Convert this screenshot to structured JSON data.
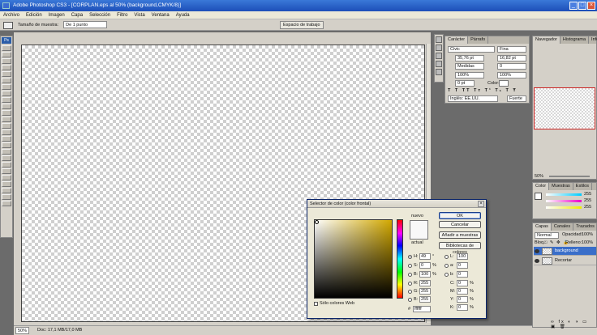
{
  "window": {
    "title": "Adobe Photoshop CS3 - [CORPLAN.eps al 50% (background,CMYK/8)]"
  },
  "menu": [
    "Archivo",
    "Edición",
    "Imagen",
    "Capa",
    "Selección",
    "Filtro",
    "Vista",
    "Ventana",
    "Ayuda"
  ],
  "options": {
    "sample_label": "Tamaño de muestra:",
    "sample_value": "De 1 punto",
    "workspace": "Espacio de trabajo"
  },
  "status": {
    "zoom": "50%",
    "doc": "Doc: 17,1 MB/17,0 MB"
  },
  "char_panel": {
    "tabs": [
      "Carácter",
      "Párrafo"
    ],
    "font": "Civic",
    "style": "Fina",
    "size": "35,76 pt",
    "leading": "16,82 pt",
    "kerning": "Medidas",
    "tracking": "0",
    "vscale": "100%",
    "hscale": "100%",
    "baseline": "0 pt",
    "color_label": "Color:",
    "language": "Inglés: EE.UU.",
    "aa": "Fuerte"
  },
  "nav_panel": {
    "tabs": [
      "Navegador",
      "Histograma",
      "Info"
    ],
    "zoom": "50%"
  },
  "color_panel": {
    "tabs": [
      "Color",
      "Muestras",
      "Estilos"
    ],
    "c": "255",
    "m": "255",
    "y": "255"
  },
  "layers_panel": {
    "tabs": [
      "Capas",
      "Canales",
      "Trazados"
    ],
    "mode": "Normal",
    "opacity_label": "Opacidad:",
    "opacity": "100%",
    "lock_label": "Bloq.:",
    "fill_label": "Relleno:",
    "fill": "100%",
    "layers": [
      {
        "name": "background",
        "selected": true
      },
      {
        "name": "Recortar",
        "selected": false
      }
    ]
  },
  "dialog": {
    "title": "Selector de color (color frontal)",
    "new_label": "nuevo",
    "current_label": "actual",
    "ok": "OK",
    "cancel": "Cancelar",
    "add_swatches": "Añadir a muestras",
    "libraries": "Bibliotecas de colores",
    "web_only": "Sólo colores Web",
    "h": "49",
    "s": "0",
    "b": "100",
    "r": "255",
    "g": "255",
    "bl": "255",
    "l": "100",
    "a": "0",
    "bb": "0",
    "c": "0",
    "m": "0",
    "y": "0",
    "k": "0",
    "hex": "ffffff",
    "deg": "°",
    "pct": "%"
  },
  "colors": {
    "titlebar": "#1d4fb8",
    "selection": "#3a6ec9"
  }
}
